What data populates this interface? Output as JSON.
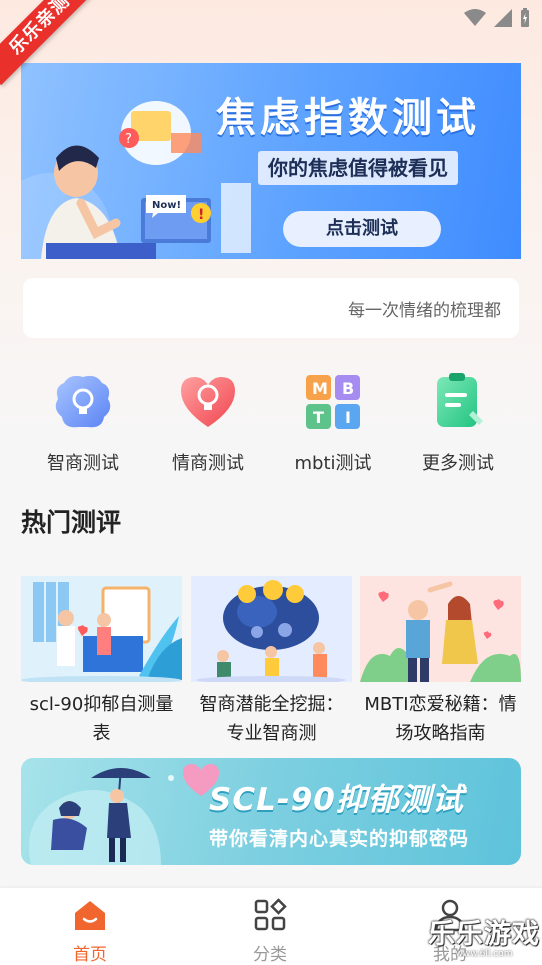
{
  "status_bar": {
    "icons": [
      "wifi-icon",
      "signal-icon",
      "battery-icon"
    ]
  },
  "corner_ribbon": "乐乐亲测",
  "banner_top": {
    "title": "焦虑指数测试",
    "subtitle": "你的焦虑值得被看见",
    "cta": "点击测试",
    "sticker": "Now!"
  },
  "notice": {
    "text": "每一次情绪的梳理都"
  },
  "categories": [
    {
      "label": "智商测试",
      "icon": "brain-icon"
    },
    {
      "label": "情商测试",
      "icon": "heart-bulb-icon"
    },
    {
      "label": "mbti测试",
      "icon": "mbti-grid-icon",
      "letters": [
        "M",
        "B",
        "T",
        "I"
      ]
    },
    {
      "label": "更多测试",
      "icon": "notepad-icon"
    }
  ],
  "section": {
    "title": "热门测评"
  },
  "cards": [
    {
      "title": "scl-90抑郁自测量表"
    },
    {
      "title": "智商潜能全挖掘：专业智商测"
    },
    {
      "title": "MBTI恋爱秘籍：情场攻略指南"
    }
  ],
  "banner_bottom": {
    "title": "SCL-90抑郁测试",
    "subtitle": "带你看清内心真实的抑郁密码"
  },
  "tabbar": {
    "tabs": [
      {
        "label": "首页",
        "icon": "home-icon",
        "active": true
      },
      {
        "label": "分类",
        "icon": "grid-icon",
        "active": false
      },
      {
        "label": "我的",
        "icon": "user-icon",
        "active": false
      }
    ]
  },
  "watermark": {
    "big": "乐乐游戏",
    "small": "www.6ll.com"
  },
  "colors": {
    "accent": "#f0662e",
    "inactive": "#999999",
    "banner_blue": "#5ea3ff",
    "ribbon": "#e9302b"
  }
}
